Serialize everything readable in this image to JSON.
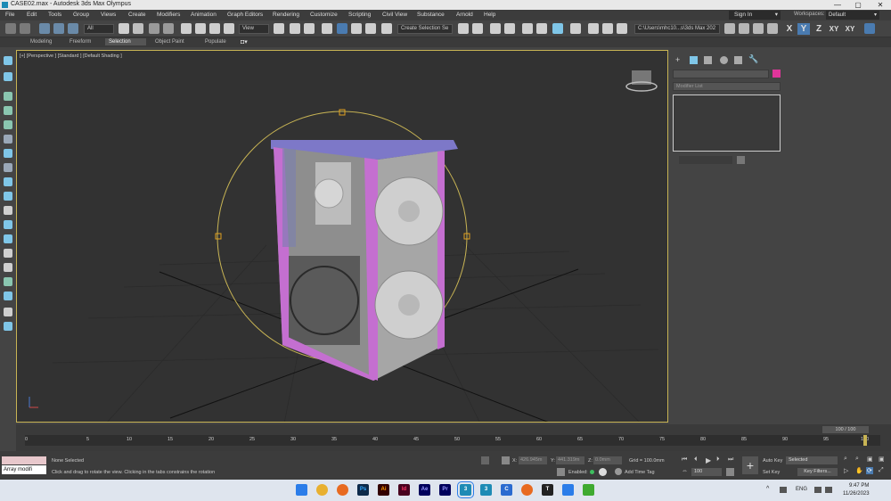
{
  "window": {
    "title": "CASE02.max - Autodesk 3ds Max Olympus",
    "minimize": "—",
    "maximize": "▢",
    "close": "✕"
  },
  "menubar": {
    "items": [
      "File",
      "Edit",
      "Tools",
      "Group",
      "Views",
      "Create",
      "Modifiers",
      "Animation",
      "Graph Editors",
      "Rendering",
      "Customize",
      "Scripting",
      "Civil View",
      "Substance",
      "Arnold",
      "Help"
    ],
    "sign_in": "Sign In",
    "workspaces_label": "Workspaces:",
    "workspace_value": "Default"
  },
  "toolbar": {
    "filter_value": "All",
    "ref_coord_value": "View",
    "selection_set_value": "Create Selection Se",
    "project_path": "C:\\Users\\mhc10...s\\3ds Max 202",
    "axis_x": "X",
    "axis_y": "Y",
    "axis_z": "Z",
    "axis_xy": "XY",
    "axis_xy2": "XY"
  },
  "ribbon": {
    "tabs": [
      "Modeling",
      "Freeform",
      "Selection",
      "Object Paint",
      "Populate"
    ],
    "active_tab": "Selection"
  },
  "viewport": {
    "label": "[+] [Perspective ] [Standard ] [Default Shading ]"
  },
  "command_panel": {
    "modifier_list_label": "Modifier List",
    "selection_color": "#e0359a"
  },
  "timeline": {
    "frame_counter": "100 / 100",
    "ticks": [
      "0",
      "5",
      "10",
      "15",
      "20",
      "25",
      "30",
      "35",
      "40",
      "45",
      "50",
      "55",
      "60",
      "65",
      "70",
      "75",
      "80",
      "85",
      "90",
      "95",
      "100"
    ]
  },
  "status": {
    "maxscript_text": "Array modifi",
    "selection_status": "None Selected",
    "prompt": "Click and drag to rotate the view.  Clicking in the tabs constrains the rotation",
    "x_label": "X:",
    "x_value": "426.945m",
    "y_label": "Y:",
    "y_value": "441.319m",
    "z_label": "Z:",
    "z_value": "0.0mm",
    "grid": "Grid = 100.0mm",
    "enabled_label": "Enabled:",
    "add_time_tag": "Add Time Tag",
    "auto_key": "Auto Key",
    "set_key": "Set Key",
    "selected_value": "Selected",
    "key_filters": "Key Filters...",
    "current_frame": "100"
  },
  "taskbar": {
    "lang": "ENG",
    "time": "9:47 PM",
    "date": "11/26/2023",
    "chevron": "^"
  }
}
